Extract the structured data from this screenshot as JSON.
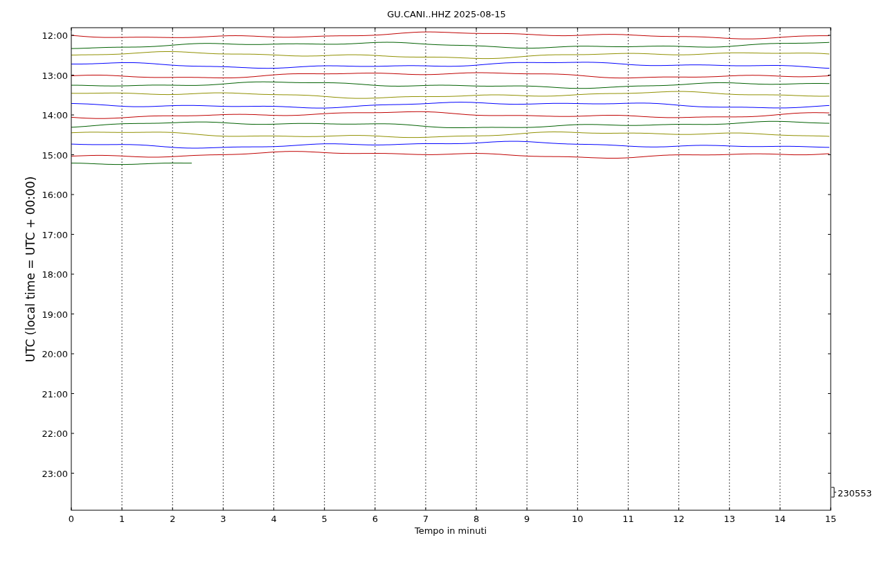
{
  "chart": {
    "title": "GU.CANI..HHZ 2025-08-15",
    "ylabel": "UTC (local time = UTC + 00:00)",
    "xlabel": "Tempo in minuti",
    "xtick_labels": [
      "0",
      "1",
      "2",
      "3",
      "4",
      "5",
      "6",
      "7",
      "8",
      "9",
      "10",
      "11",
      "12",
      "13",
      "14",
      "15"
    ],
    "ytick_labels": [
      "12:00",
      "13:00",
      "14:00",
      "15:00",
      "16:00",
      "17:00",
      "18:00",
      "19:00",
      "20:00",
      "21:00",
      "22:00",
      "23:00"
    ],
    "scale_label": "230553"
  }
}
